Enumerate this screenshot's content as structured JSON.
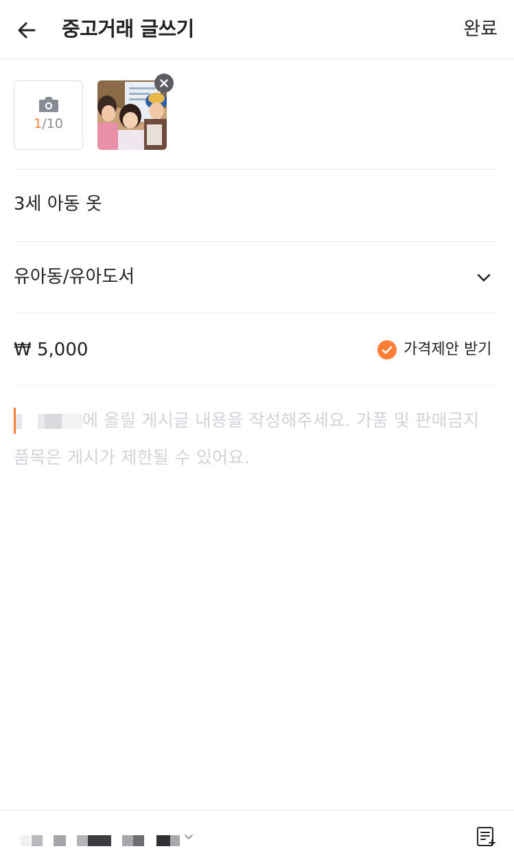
{
  "header": {
    "title": "중고거래 글쓰기",
    "done_label": "완료"
  },
  "photos": {
    "count_current": "1",
    "count_total": "/10",
    "icons": [
      "camera-icon",
      "close-icon"
    ]
  },
  "form": {
    "title_value": "3세 아동 옷",
    "category_value": "유아동/유아도서",
    "price_value": "₩ 5,000",
    "offer_label": "가격제안 받기",
    "offer_checked": true,
    "description_placeholder_line1": "에 올릴 게시글 내용을 작성해주세요. 가품 및 판매금지",
    "description_placeholder_line2": "품목은 게시가 제한될 수 있어요."
  },
  "colors": {
    "accent": "#ff7e36",
    "placeholder": "#d1d3d8",
    "divider": "#e9ecef"
  }
}
